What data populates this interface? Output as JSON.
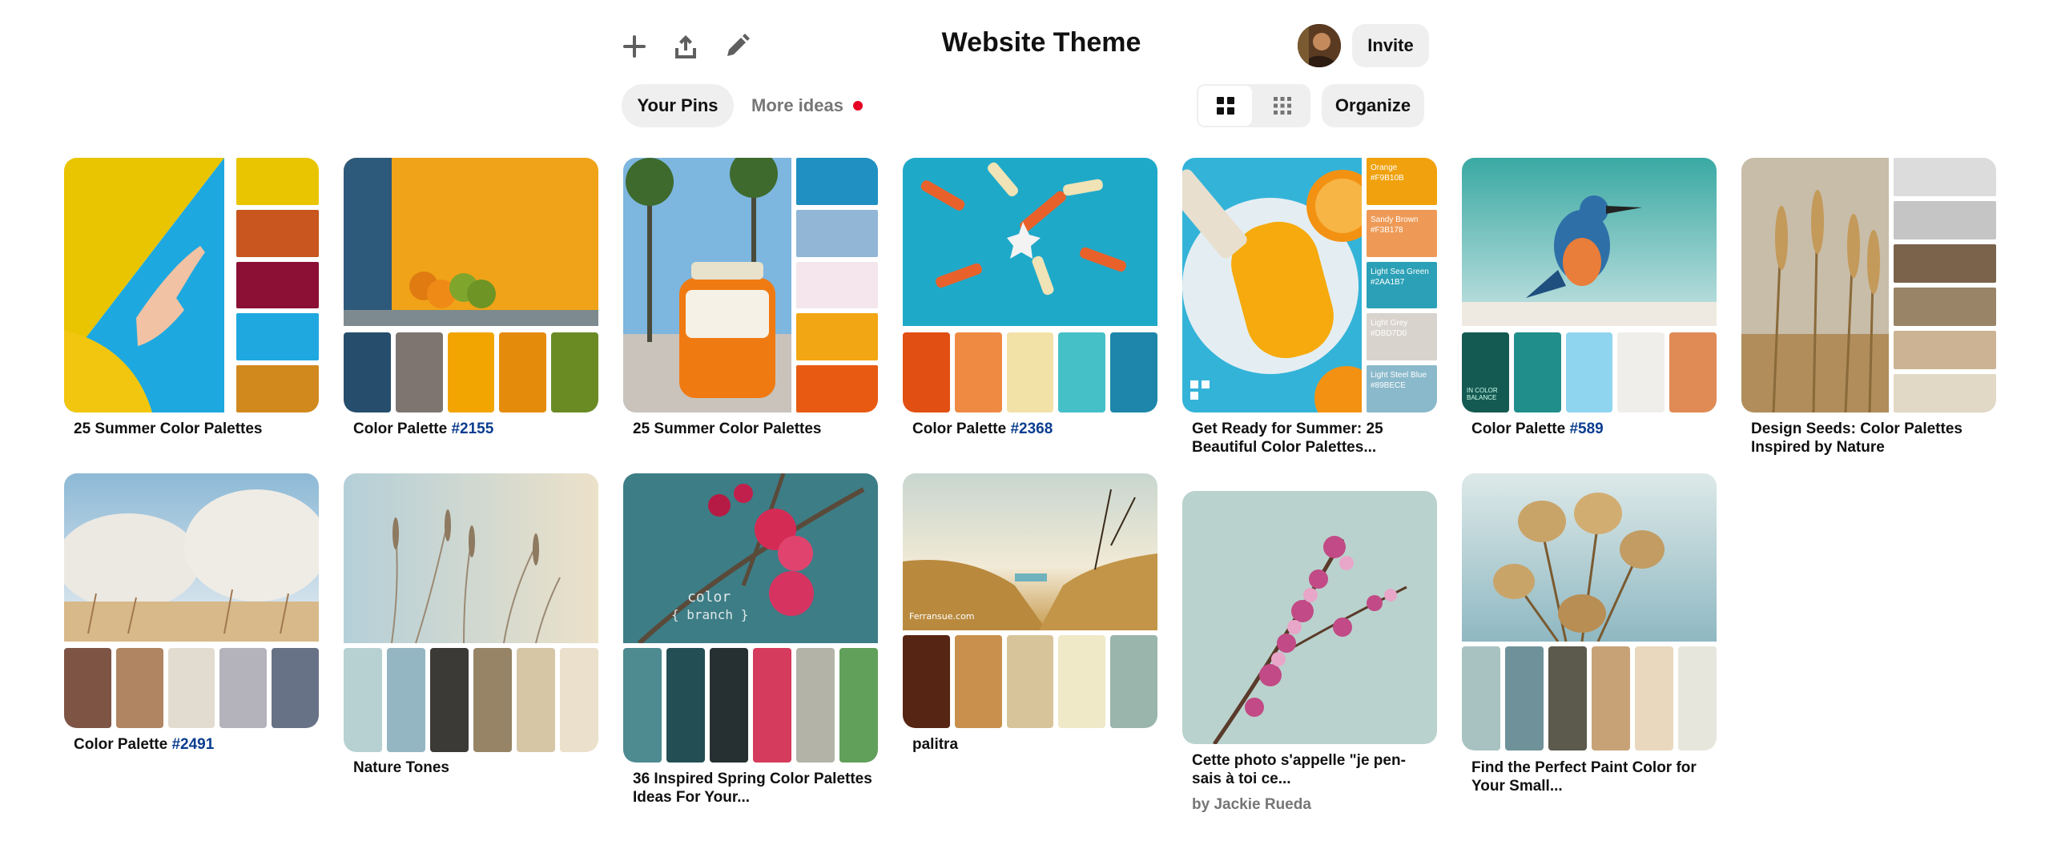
{
  "header": {
    "board_title": "Website Theme",
    "invite_label": "Invite",
    "organize_label": "Organize",
    "tabs": {
      "your_pins": "Your Pins",
      "more_ideas": "More ideas"
    },
    "accent_red": "#e60023"
  },
  "pins": [
    {
      "title": "25 Summer Color Palettes",
      "title_number": ""
    },
    {
      "title": "Color Palette ",
      "title_number": "#2155"
    },
    {
      "title": "25 Summer Color Palettes",
      "title_number": ""
    },
    {
      "title": "Color Palette ",
      "title_number": "#2368"
    },
    {
      "title": "Get Ready for Summer: 25 Beautiful Color Palettes...",
      "title_number": "",
      "labels": [
        "Orange",
        "Sandy Brown",
        "Light Sea Green",
        "Light Grey",
        "Light Steel Blue"
      ],
      "codes": [
        "#F9B10B",
        "#F3B178",
        "#2AA1B7",
        "#DBD7D0",
        "#89BECE"
      ]
    },
    {
      "title": "Color Palette ",
      "title_number": "#589",
      "overlay": "in color balance"
    },
    {
      "title": "Design Seeds: Color Palettes Inspired by Nature",
      "title_number": ""
    },
    {
      "title": "Color Palette ",
      "title_number": "#2491"
    },
    {
      "title": "Nature Tones",
      "title_number": ""
    },
    {
      "title": "36 Inspired Spring Color Palettes Ideas For Your...",
      "title_number": "",
      "overlay_line1": "color",
      "overlay_line2": "{ branch }"
    },
    {
      "title": "palitra",
      "title_number": "",
      "overlay": "Ferransue.com"
    },
    {
      "title": "Cette photo s'appelle \"je pen-sais à toi ce...",
      "title_number": "",
      "byline": "by Jackie Rueda"
    },
    {
      "title": "Find the Perfect Paint Color for Your Small...",
      "title_number": ""
    }
  ]
}
